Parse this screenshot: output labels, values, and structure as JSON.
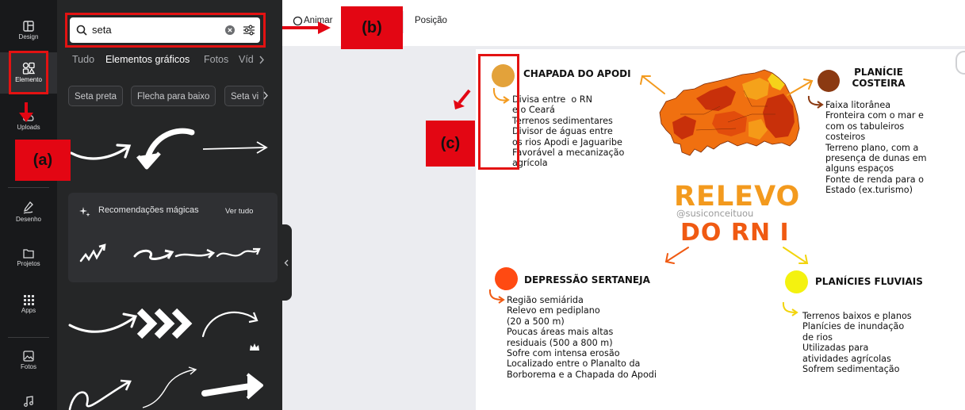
{
  "rail": {
    "items": [
      {
        "label": "Design",
        "icon": "layout-icon"
      },
      {
        "label": "Elemento",
        "icon": "shapes-icon"
      },
      {
        "label": "Uploads",
        "icon": "cloud-upload-icon"
      },
      {
        "label": "Desenho",
        "icon": "pen-icon"
      },
      {
        "label": "Projetos",
        "icon": "folder-icon"
      },
      {
        "label": "Apps",
        "icon": "grid-icon"
      },
      {
        "label": "Fotos",
        "icon": "image-icon"
      },
      {
        "label": "",
        "icon": "music-icon"
      }
    ]
  },
  "panel": {
    "search_value": "seta",
    "tabs": [
      "Tudo",
      "Elementos gráficos",
      "Fotos",
      "Víd"
    ],
    "chips": [
      "Seta preta",
      "Flecha para baixo",
      "Seta vi"
    ],
    "magic": {
      "title": "Recomendações mágicas",
      "link": "Ver tudo"
    }
  },
  "topbar": {
    "animate": "Animar",
    "position": "Posição"
  },
  "annotations": {
    "a": "(a)",
    "b": "(b)",
    "c": "(c)",
    "color": "#e30613"
  },
  "infographic": {
    "chapada": {
      "title": "CHAPADA DO APODI",
      "body": "Divisa entre  o RN\ne o Ceará\nTerrenos sedimentares\nDivisor de águas entre\nos rios Apodi e Jaguaribe\nFavorável a mecanização\nagrícola"
    },
    "planicie": {
      "title": "PLANÍCIE\nCOSTEIRA",
      "body": "Faixa litorânea\nFronteira com o mar e\ncom os tabuleiros\ncosteiros\nTerreno plano, com a\npresença de dunas em\nalguns espaços\nFonte de renda para o\nEstado (ex.turismo)"
    },
    "relevo": "RELEVO",
    "handle": "@susiconceituou",
    "dorn": "DO RN I",
    "depressao": {
      "title": "DEPRESSÃO SERTANEJA",
      "body": "Região semiárida\nRelevo em pediplano\n(20 a 500 m)\nPoucas áreas mais altas\nresiduais (500 a 800 m)\nSofre com intensa erosão\nLocalizado entre o Planalto da\nBorborema e a Chapada do Apodi"
    },
    "fluviais": {
      "title": "PLANÍCIES FLUVIAIS",
      "body": "Terrenos baixos e planos\nPlanícies de inundação\nde rios\nUtilizadas para\natividades agrícolas\nSofrem sedimentação"
    },
    "colors": {
      "chapada": "#e3a23a",
      "planicie": "#8b3a12",
      "depressao": "#ff4a12",
      "fluviais": "#f4f20f"
    }
  }
}
